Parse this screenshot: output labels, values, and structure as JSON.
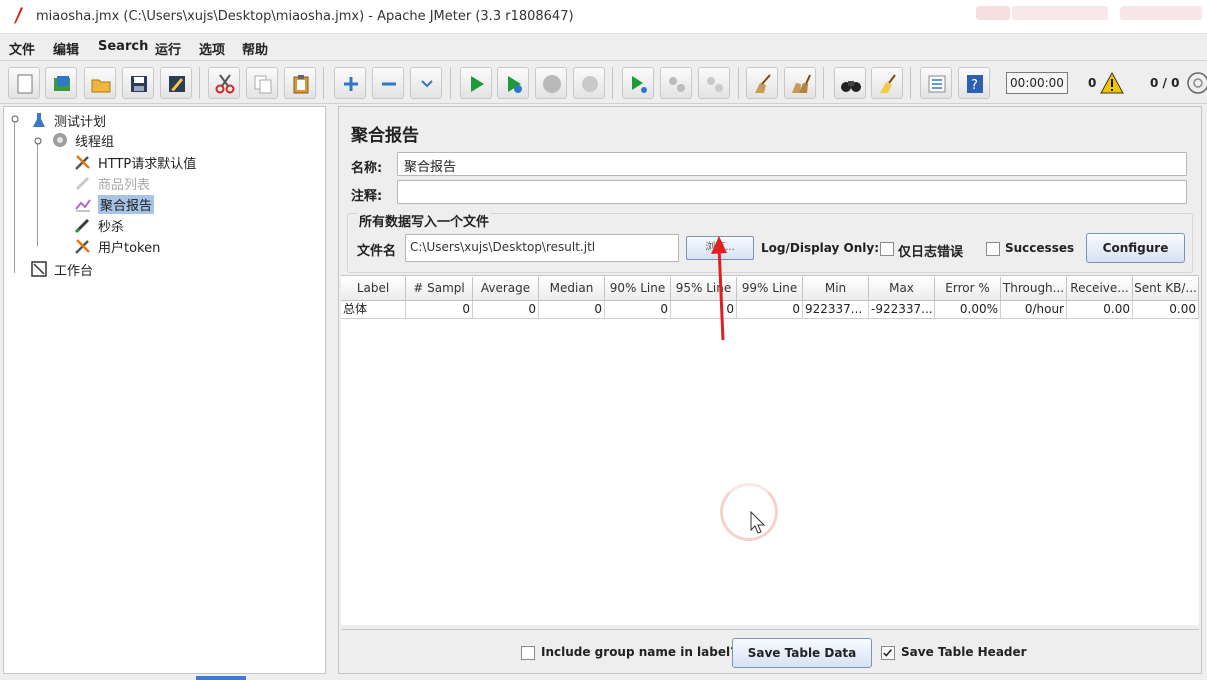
{
  "window": {
    "title": "miaosha.jmx (C:\\Users\\xujs\\Desktop\\miaosha.jmx) - Apache JMeter (3.3 r1808647)"
  },
  "menu": {
    "items": [
      "文件",
      "编辑",
      "Search",
      "运行",
      "选项",
      "帮助"
    ]
  },
  "toolbar": {
    "timer": "00:00:00",
    "error_count": "0",
    "thread_count": "0 / 0",
    "buttons": [
      "new-icon",
      "templates-icon",
      "open-icon",
      "save-icon",
      "save-as-icon",
      "cut-icon",
      "copy-icon",
      "paste-icon",
      "expand-icon",
      "collapse-icon",
      "toggle-icon",
      "start-icon",
      "start-no-pause-icon",
      "stop-icon",
      "shutdown-icon",
      "remote-start-icon",
      "remote-stop-icon",
      "remote-shutdown-icon",
      "clear-icon",
      "clear-all-icon",
      "search-icon",
      "reset-search-icon",
      "function-helper-icon",
      "help-icon"
    ]
  },
  "tree": {
    "nodes": [
      {
        "label": "测试计划",
        "icon": "test-plan-icon",
        "state": "normal"
      },
      {
        "label": "线程组",
        "icon": "gear-icon",
        "state": "normal"
      },
      {
        "label": "HTTP请求默认值",
        "icon": "wrench-icon",
        "state": "normal"
      },
      {
        "label": "商品列表",
        "icon": "pen-icon",
        "state": "disabled"
      },
      {
        "label": "聚合报告",
        "icon": "chart-icon",
        "state": "selected"
      },
      {
        "label": "秒杀",
        "icon": "pen-icon",
        "state": "normal"
      },
      {
        "label": "用户token",
        "icon": "wrench-icon",
        "state": "normal"
      },
      {
        "label": "工作台",
        "icon": "workbench-icon",
        "state": "normal"
      }
    ]
  },
  "panel": {
    "title": "聚合报告",
    "name_label": "名称:",
    "name_value": "聚合报告",
    "comment_label": "注释:",
    "comment_value": "",
    "file_group_title": "所有数据写入一个文件",
    "file_label": "文件名",
    "file_path": "C:\\Users\\xujs\\Desktop\\result.jtl",
    "browse_label": "浏览...",
    "logdisplay_label": "Log/Display Only:",
    "errors_only_label": "仅日志错误",
    "successes_label": "Successes",
    "configure_label": "Configure"
  },
  "table": {
    "columns": [
      "Label",
      "# Sampl",
      "Average",
      "Median",
      "90% Line",
      "95% Line",
      "99% Line",
      "Min",
      "Max",
      "Error %",
      "Through...",
      "Receive...",
      "Sent KB/..."
    ],
    "rows": [
      [
        "总体",
        "0",
        "0",
        "0",
        "0",
        "0",
        "0",
        "922337...",
        "-922337...",
        "0.00%",
        "0/hour",
        "0.00",
        "0.00"
      ]
    ]
  },
  "bottom": {
    "include_group_label": "Include group name in label?",
    "save_table_label": "Save Table Data",
    "save_header_label": "Save Table Header",
    "save_header_checked": true
  },
  "colors": {
    "accent": "#3c7bd6",
    "selection": "#a7c4e6",
    "annotation_arrow": "#e02020"
  }
}
